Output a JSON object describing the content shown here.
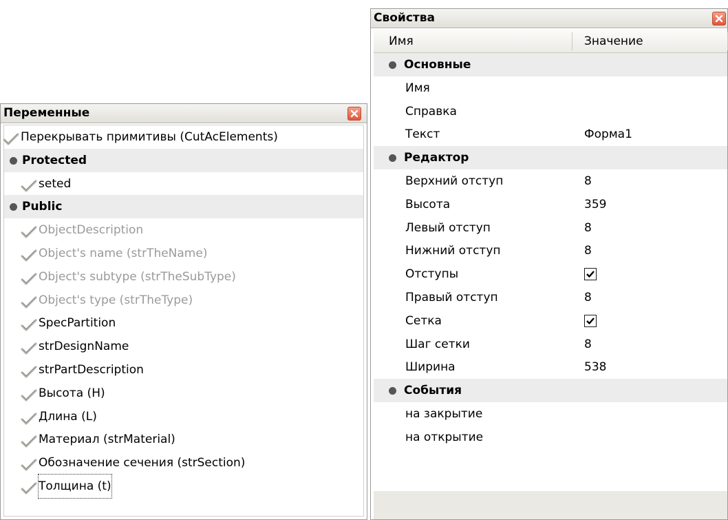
{
  "variables_panel": {
    "title": "Переменные",
    "rows": [
      {
        "kind": "item",
        "label": "Перекрывать примитивы (CutAcElements)",
        "indent": 0,
        "dim": false
      },
      {
        "kind": "group",
        "label": "Protected"
      },
      {
        "kind": "item",
        "label": "seted",
        "indent": 1,
        "dim": false
      },
      {
        "kind": "group",
        "label": "Public"
      },
      {
        "kind": "item",
        "label": "ObjectDescription",
        "indent": 1,
        "dim": true
      },
      {
        "kind": "item",
        "label": "Object's name (strTheName)",
        "indent": 1,
        "dim": true
      },
      {
        "kind": "item",
        "label": "Object's subtype (strTheSubType)",
        "indent": 1,
        "dim": true
      },
      {
        "kind": "item",
        "label": "Object's type (strTheType)",
        "indent": 1,
        "dim": true
      },
      {
        "kind": "item",
        "label": "SpecPartition",
        "indent": 1,
        "dim": false
      },
      {
        "kind": "item",
        "label": "strDesignName",
        "indent": 1,
        "dim": false
      },
      {
        "kind": "item",
        "label": "strPartDescription",
        "indent": 1,
        "dim": false
      },
      {
        "kind": "item",
        "label": "Высота (H)",
        "indent": 1,
        "dim": false
      },
      {
        "kind": "item",
        "label": "Длина (L)",
        "indent": 1,
        "dim": false
      },
      {
        "kind": "item",
        "label": "Материал (strMaterial)",
        "indent": 1,
        "dim": false
      },
      {
        "kind": "item",
        "label": "Обозначение сечения (strSection)",
        "indent": 1,
        "dim": false
      },
      {
        "kind": "item",
        "label": "Толщина (t)",
        "indent": 1,
        "dim": false,
        "focused": true
      }
    ]
  },
  "properties_panel": {
    "title": "Свойства",
    "columns": {
      "name": "Имя",
      "value": "Значение"
    },
    "rows": [
      {
        "kind": "group",
        "name": "Основные"
      },
      {
        "kind": "prop",
        "name": "Имя",
        "value": ""
      },
      {
        "kind": "prop",
        "name": "Справка",
        "value": ""
      },
      {
        "kind": "prop",
        "name": "Текст",
        "value": "Форма1"
      },
      {
        "kind": "group",
        "name": "Редактор"
      },
      {
        "kind": "prop",
        "name": "Верхний отступ",
        "value": "8"
      },
      {
        "kind": "prop",
        "name": "Высота",
        "value": "359"
      },
      {
        "kind": "prop",
        "name": "Левый отступ",
        "value": "8"
      },
      {
        "kind": "prop",
        "name": "Нижний отступ",
        "value": "8"
      },
      {
        "kind": "prop",
        "name": "Отступы",
        "checkbox": true,
        "checked": true
      },
      {
        "kind": "prop",
        "name": "Правый отступ",
        "value": "8"
      },
      {
        "kind": "prop",
        "name": "Сетка",
        "checkbox": true,
        "checked": true
      },
      {
        "kind": "prop",
        "name": "Шаг сетки",
        "value": "8"
      },
      {
        "kind": "prop",
        "name": "Ширина",
        "value": "538"
      },
      {
        "kind": "group",
        "name": "События"
      },
      {
        "kind": "prop",
        "name": "на закрытие",
        "value": ""
      },
      {
        "kind": "prop",
        "name": "на открытие",
        "value": ""
      }
    ]
  },
  "icons": {
    "item": "checkmark-icon",
    "group": "bullet-icon",
    "close": "close-icon"
  },
  "colors": {
    "group_background": "#ececec",
    "dim_text": "#9a9a9a",
    "close_button": "#e0563a"
  }
}
